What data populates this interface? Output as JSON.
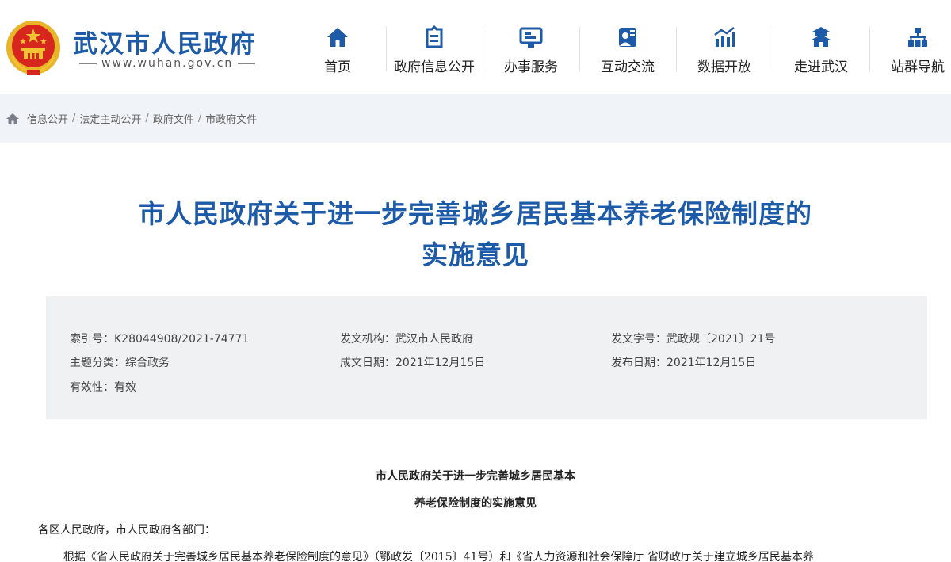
{
  "header": {
    "site_title": "武汉市人民政府",
    "site_url": "www.wuhan.gov.cn",
    "nav": [
      {
        "label": "首页",
        "icon": "home-icon"
      },
      {
        "label": "政府信息公开",
        "icon": "info-open-icon"
      },
      {
        "label": "办事服务",
        "icon": "service-icon"
      },
      {
        "label": "互动交流",
        "icon": "interaction-icon"
      },
      {
        "label": "数据开放",
        "icon": "data-chart-icon"
      },
      {
        "label": "走进武汉",
        "icon": "building-icon"
      },
      {
        "label": "站群导航",
        "icon": "site-group-icon"
      }
    ]
  },
  "breadcrumb": [
    "信息公开",
    "法定主动公开",
    "政府文件",
    "市政府文件"
  ],
  "document": {
    "title_line1": "市人民政府关于进一步完善城乡居民基本养老保险制度的",
    "title_line2": "实施意见",
    "meta": {
      "index_label": "索引号：",
      "index_value": "K28044908/2021-74771",
      "issuer_label": "发文机构：",
      "issuer_value": "武汉市人民政府",
      "doc_no_label": "发文字号：",
      "doc_no_value": "武政规〔2021〕21号",
      "topic_label": "主题分类：",
      "topic_value": "综合政务",
      "created_label": "成文日期：",
      "created_value": "2021年12月15日",
      "published_label": "发布日期：",
      "published_value": "2021年12月15日",
      "validity_label": "有效性：",
      "validity_value": "有效"
    },
    "body_title_line1": "市人民政府关于进一步完善城乡居民基本",
    "body_title_line2": "养老保险制度的实施意见",
    "salutation": "各区人民政府，市人民政府各部门：",
    "paragraph_start": "根据《省人民政府关于完善城乡居民基本养老保险制度的意见》（鄂政发〔2015〕41号）和《省人力资源和社会保障厅 省财政厅关于建立城乡居民基本养"
  },
  "colors": {
    "brand_blue": "#1d5aa7",
    "crumb_bg": "#f0f3f8",
    "meta_bg": "#f0f1f3",
    "emblem_red": "#d7261e",
    "emblem_gold": "#f2c230"
  }
}
